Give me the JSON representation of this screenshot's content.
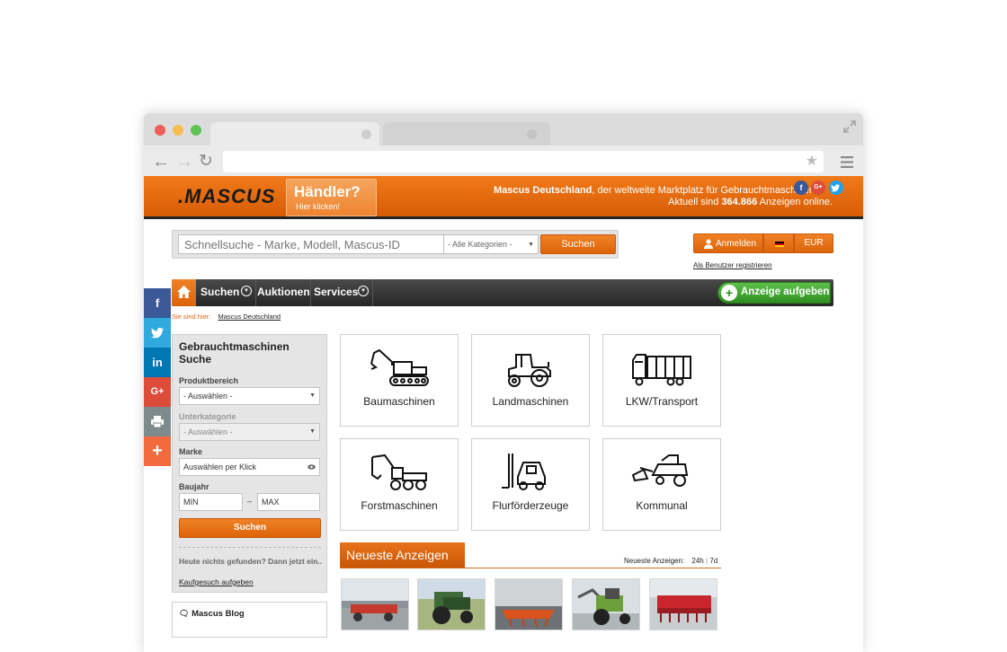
{
  "header": {
    "logo_text": ".MASCUS",
    "dealer_title": "Händler?",
    "dealer_sub": "Hier klicken!",
    "tagline_brand": "Mascus Deutschland",
    "tagline_rest": ", der weltweite Marktplatz für Gebrauchtmaschinen",
    "tagline2_pre": "Aktuell sind ",
    "tagline2_count": "364.866",
    "tagline2_post": " Anzeigen online."
  },
  "search": {
    "placeholder": "Schnellsuche - Marke, Modell, Mascus-ID",
    "category": "- Alle Kategorien -",
    "button": "Suchen"
  },
  "account": {
    "login": "Anmelden",
    "currency": "EUR",
    "register": "Als Benutzer registrieren"
  },
  "nav": {
    "items": [
      "Suchen",
      "Auktionen",
      "Services"
    ],
    "add_listing": "Anzeige aufgeben"
  },
  "breadcrumb": {
    "prefix": "Sie sind hier:",
    "current": "Mascus Deutschland"
  },
  "filter": {
    "title": "Gebrauchtmaschinen Suche",
    "product_label": "Produktbereich",
    "product_value": "- Auswählen -",
    "sub_label": "Unterkategorie",
    "sub_value": "- Auswählen -",
    "brand_label": "Marke",
    "brand_value": "Auswählen per Klick",
    "year_label": "Baujahr",
    "year_min": "MIN",
    "year_max": "MAX",
    "year_dash": "–",
    "button": "Suchen",
    "not_found": "Heute nichts gefunden? Dann jetzt ein..",
    "wish_link": "Kaufgesuch aufgeben"
  },
  "blog": {
    "title": "Mascus Blog"
  },
  "categories": [
    {
      "label": "Baumaschinen",
      "icon": "excavator-icon"
    },
    {
      "label": "Landmaschinen",
      "icon": "tractor-icon"
    },
    {
      "label": "LKW/Transport",
      "icon": "truck-icon"
    },
    {
      "label": "Forstmaschinen",
      "icon": "forestry-icon"
    },
    {
      "label": "Flurförderzeuge",
      "icon": "forklift-icon"
    },
    {
      "label": "Kommunal",
      "icon": "mower-icon"
    }
  ],
  "newest": {
    "title": "Neueste Anzeigen",
    "filter_label": "Neueste Anzeigen:",
    "range_24h": "24h",
    "range_sep": "|",
    "range_7d": "7d"
  },
  "colors": {
    "brand_orange": "#e8731a",
    "nav_dark": "#2e2e2e",
    "add_green": "#3aa12a"
  }
}
